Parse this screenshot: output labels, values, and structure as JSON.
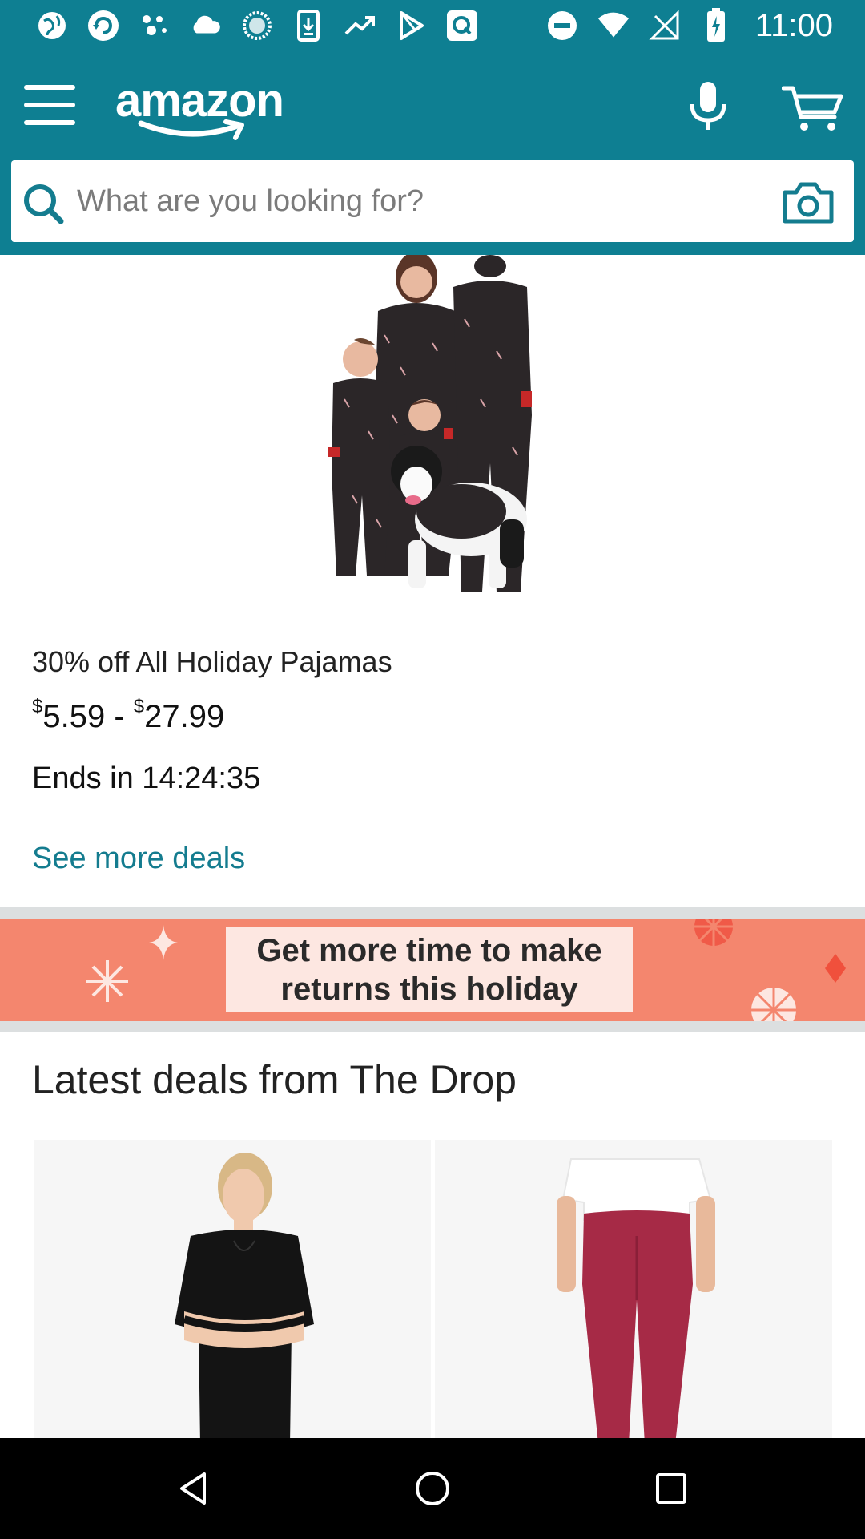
{
  "status_bar": {
    "time": "11:00",
    "left_icons": [
      "globe-icon",
      "refresh-icon",
      "dots-icon",
      "cloud-icon",
      "circle-icon",
      "download-icon",
      "trend-icon",
      "play-icon",
      "q-icon"
    ],
    "right_icons": [
      "dnd-icon",
      "wifi-icon",
      "no-signal-icon",
      "battery-icon"
    ]
  },
  "header": {
    "logo_text": "amazon",
    "search_placeholder": "What are you looking for?",
    "colors": {
      "background": "#0e7f92",
      "accent": "#147c8f"
    }
  },
  "deal": {
    "title": "30% off All Holiday Pajamas",
    "price_currency_1": "$",
    "price_low": "5.59",
    "price_sep": " - ",
    "price_currency_2": "$",
    "price_high": "27.99",
    "ends": "Ends in 14:24:35",
    "see_more": "See more deals"
  },
  "banner": {
    "line1": "Get more time to make",
    "line2": "returns this holiday",
    "colors": {
      "background": "#f4866e",
      "box": "#fde7e1"
    }
  },
  "drop_section": {
    "title": "Latest deals from The Drop",
    "cards": [
      {
        "icon": "black-dress-product-image"
      },
      {
        "icon": "red-leggings-product-image"
      }
    ]
  },
  "nav_bar": {
    "buttons": [
      "back-icon",
      "home-icon",
      "recents-icon"
    ]
  }
}
